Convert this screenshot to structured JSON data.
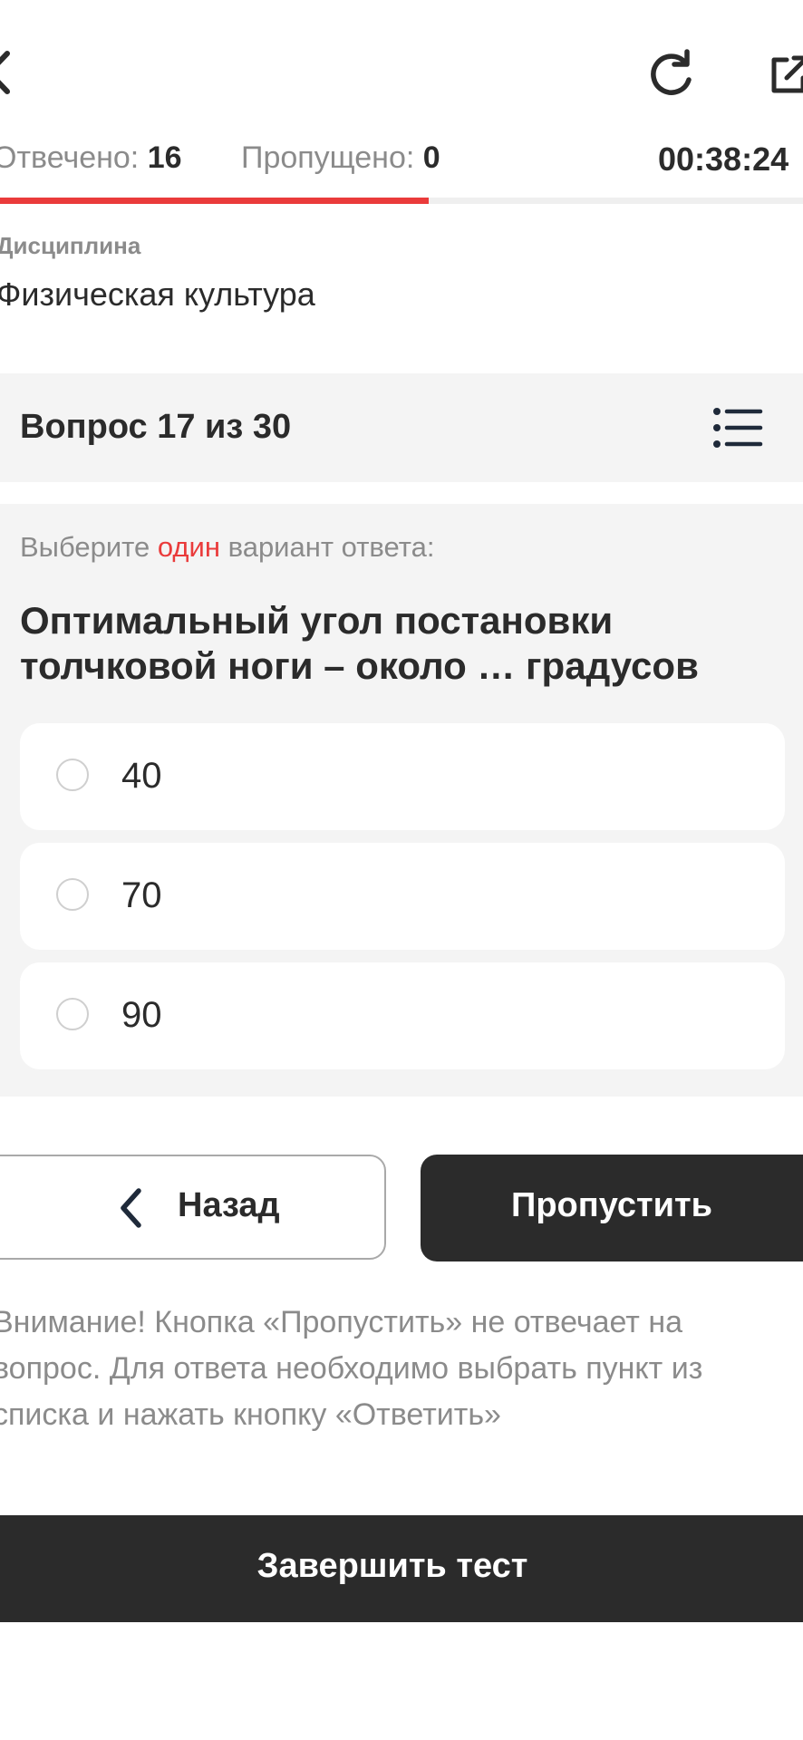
{
  "header": {
    "icons": [
      "back-icon",
      "reload-icon",
      "share-icon"
    ]
  },
  "status": {
    "answered_label": "Отвечено:",
    "answered_value": "16",
    "skipped_label": "Пропущено:",
    "skipped_value": "0",
    "timer": "00:38:24",
    "progress_fraction": 0.534,
    "progress_color": "#ea3b3b"
  },
  "discipline": {
    "label": "Дисциплина",
    "value": "Физическая культура"
  },
  "question_header": {
    "text": "Вопрос 17 из 30",
    "icon": "list-icon"
  },
  "question": {
    "hint_prefix": "Выберите ",
    "hint_accent": "один",
    "hint_suffix": " вариант ответа:",
    "text": "Оптимальный угол постановки толчковой ноги – около … градусов",
    "options": [
      {
        "label": "40"
      },
      {
        "label": "70"
      },
      {
        "label": "90"
      }
    ]
  },
  "buttons": {
    "back_label": "Назад",
    "skip_label": "Пропустить",
    "finish_label": "Завершить тест"
  },
  "notice": "Внимание! Кнопка «Пропустить» не отвечает на вопрос. Для ответа необходимо выбрать пункт из списка и нажать кнопку «Ответить»",
  "colors": {
    "accent": "#ea3b3b",
    "dark": "#2b2b2b",
    "card": "#f4f4f4",
    "muted": "#8b8b8b"
  }
}
